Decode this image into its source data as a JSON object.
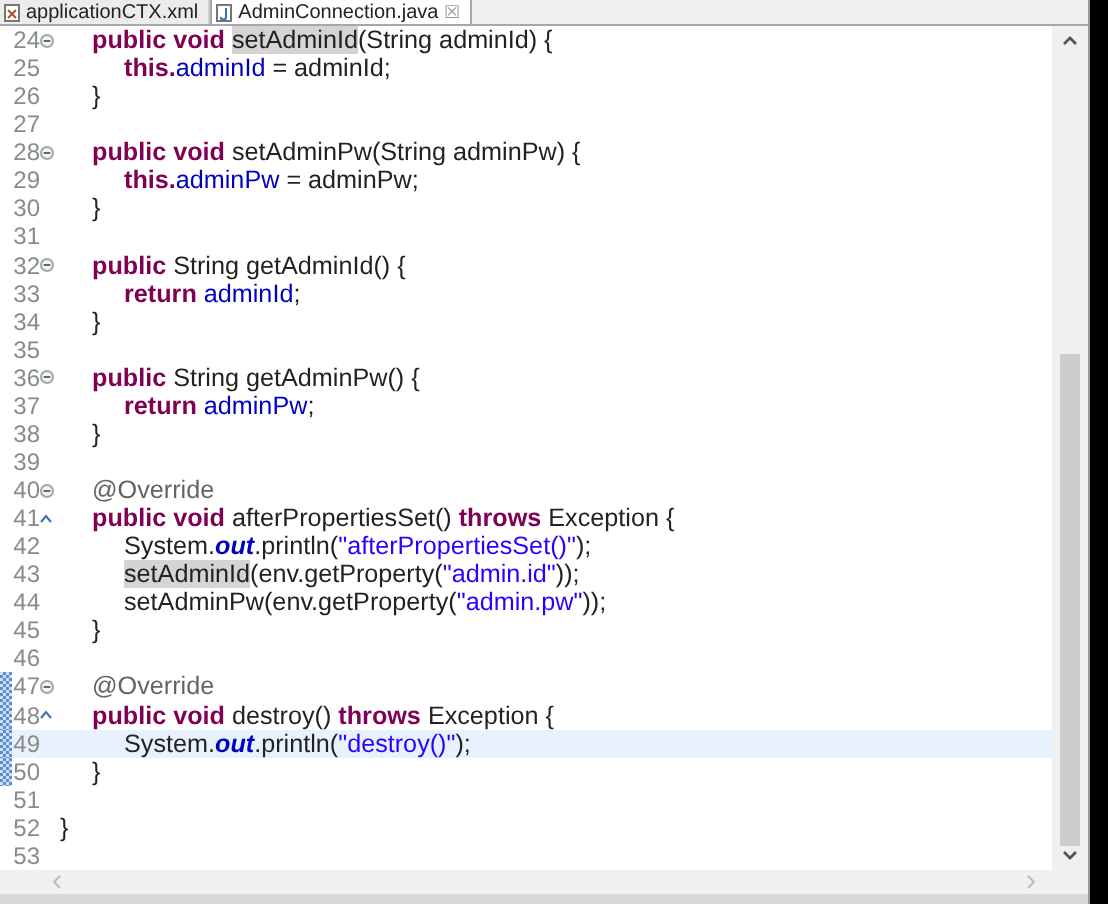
{
  "tabs": [
    {
      "label": "applicationCTX.xml",
      "kind": "xml",
      "selected": false
    },
    {
      "label": "AdminConnection.java",
      "kind": "java",
      "selected": true,
      "close": "☒"
    }
  ],
  "editor": {
    "lines": [
      {
        "number": "24",
        "fold": true,
        "override": false,
        "changed": false,
        "current": false,
        "tokens": [
          {
            "text": "\tpublic void ",
            "kind": "keyword"
          },
          {
            "text": "setAdminId",
            "kind": "occurrence"
          },
          {
            "text": "(String adminId) {",
            "kind": "plain"
          }
        ]
      },
      {
        "number": "25",
        "fold": false,
        "override": false,
        "changed": false,
        "current": false,
        "tokens": [
          {
            "text": "\t\tthis.",
            "kind": "keyword"
          },
          {
            "text": "adminId",
            "kind": "field"
          },
          {
            "text": " = adminId;",
            "kind": "plain"
          }
        ]
      },
      {
        "number": "26",
        "fold": false,
        "override": false,
        "changed": false,
        "current": false,
        "tokens": [
          {
            "text": "\t}",
            "kind": "plain"
          }
        ]
      },
      {
        "number": "27",
        "fold": false,
        "override": false,
        "changed": false,
        "current": false
      },
      {
        "number": "28",
        "fold": true,
        "override": false,
        "changed": false,
        "current": false,
        "tokens": [
          {
            "text": "\tpublic void ",
            "kind": "keyword"
          },
          {
            "text": "setAdminPw(String adminPw) {",
            "kind": "plain"
          }
        ]
      },
      {
        "number": "29",
        "fold": false,
        "override": false,
        "changed": false,
        "current": false,
        "tokens": [
          {
            "text": "\t\tthis.",
            "kind": "keyword"
          },
          {
            "text": "adminPw",
            "kind": "field"
          },
          {
            "text": " = adminPw;",
            "kind": "plain"
          }
        ]
      },
      {
        "number": "30",
        "fold": false,
        "override": false,
        "changed": false,
        "current": false,
        "tokens": [
          {
            "text": "\t}",
            "kind": "plain"
          }
        ]
      },
      {
        "number": "31",
        "fold": false,
        "override": false,
        "changed": false,
        "current": false
      },
      {
        "number": "32",
        "fold": true,
        "override": false,
        "changed": false,
        "current": false,
        "tokens": [
          {
            "text": "\tpublic ",
            "kind": "keyword"
          },
          {
            "text": "String getAdminId() {",
            "kind": "plain"
          }
        ]
      },
      {
        "number": "33",
        "fold": false,
        "override": false,
        "changed": false,
        "current": false,
        "tokens": [
          {
            "text": "\t\treturn ",
            "kind": "keyword"
          },
          {
            "text": "adminId",
            "kind": "field"
          },
          {
            "text": ";",
            "kind": "plain"
          }
        ]
      },
      {
        "number": "34",
        "fold": false,
        "override": false,
        "changed": false,
        "current": false,
        "tokens": [
          {
            "text": "\t}",
            "kind": "plain"
          }
        ]
      },
      {
        "number": "35",
        "fold": false,
        "override": false,
        "changed": false,
        "current": false
      },
      {
        "number": "36",
        "fold": true,
        "override": false,
        "changed": false,
        "current": false,
        "tokens": [
          {
            "text": "\tpublic ",
            "kind": "keyword"
          },
          {
            "text": "String getAdminPw() {",
            "kind": "plain"
          }
        ]
      },
      {
        "number": "37",
        "fold": false,
        "override": false,
        "changed": false,
        "current": false,
        "tokens": [
          {
            "text": "\t\treturn ",
            "kind": "keyword"
          },
          {
            "text": "adminPw",
            "kind": "field"
          },
          {
            "text": ";",
            "kind": "plain"
          }
        ]
      },
      {
        "number": "38",
        "fold": false,
        "override": false,
        "changed": false,
        "current": false,
        "tokens": [
          {
            "text": "\t}",
            "kind": "plain"
          }
        ]
      },
      {
        "number": "39",
        "fold": false,
        "override": false,
        "changed": false,
        "current": false
      },
      {
        "number": "40",
        "fold": true,
        "override": false,
        "changed": false,
        "current": false,
        "tokens": [
          {
            "text": "\t@Override",
            "kind": "annotation"
          }
        ]
      },
      {
        "number": "41",
        "fold": false,
        "override": true,
        "changed": false,
        "current": false,
        "tokens": [
          {
            "text": "\tpublic void ",
            "kind": "keyword"
          },
          {
            "text": "afterPropertiesSet() ",
            "kind": "plain"
          },
          {
            "text": "throws ",
            "kind": "keyword"
          },
          {
            "text": "Exception {",
            "kind": "plain"
          }
        ]
      },
      {
        "number": "42",
        "fold": false,
        "override": false,
        "changed": false,
        "current": false,
        "tokens": [
          {
            "text": "\t\tSystem.",
            "kind": "plain"
          },
          {
            "text": "out",
            "kind": "static"
          },
          {
            "text": ".println(",
            "kind": "plain"
          },
          {
            "text": "\"afterPropertiesSet()\"",
            "kind": "string"
          },
          {
            "text": ");",
            "kind": "plain"
          }
        ]
      },
      {
        "number": "43",
        "fold": false,
        "override": false,
        "changed": false,
        "current": false,
        "tokens": [
          {
            "text": "\t\tsetAdminId",
            "kind": "occurrence"
          },
          {
            "text": "(env.getProperty(",
            "kind": "plain"
          },
          {
            "text": "\"admin.id\"",
            "kind": "string"
          },
          {
            "text": "));",
            "kind": "plain"
          }
        ]
      },
      {
        "number": "44",
        "fold": false,
        "override": false,
        "changed": false,
        "current": false,
        "tokens": [
          {
            "text": "\t\tsetAdminPw(env.getProperty(",
            "kind": "plain"
          },
          {
            "text": "\"admin.pw\"",
            "kind": "string"
          },
          {
            "text": "));",
            "kind": "plain"
          }
        ]
      },
      {
        "number": "45",
        "fold": false,
        "override": false,
        "changed": false,
        "current": false,
        "tokens": [
          {
            "text": "\t}",
            "kind": "plain"
          }
        ]
      },
      {
        "number": "46",
        "fold": false,
        "override": false,
        "changed": false,
        "current": false
      },
      {
        "number": "47",
        "fold": true,
        "override": false,
        "changed": true,
        "current": false,
        "tokens": [
          {
            "text": "\t@Override",
            "kind": "annotation"
          }
        ]
      },
      {
        "number": "48",
        "fold": false,
        "override": true,
        "changed": true,
        "current": false,
        "tokens": [
          {
            "text": "\tpublic void ",
            "kind": "keyword"
          },
          {
            "text": "destroy() ",
            "kind": "plain"
          },
          {
            "text": "throws ",
            "kind": "keyword"
          },
          {
            "text": "Exception {",
            "kind": "plain"
          }
        ]
      },
      {
        "number": "49",
        "fold": false,
        "override": false,
        "changed": true,
        "current": true,
        "tokens": [
          {
            "text": "\t\tSystem.",
            "kind": "plain"
          },
          {
            "text": "out",
            "kind": "static"
          },
          {
            "text": ".println(",
            "kind": "plain"
          },
          {
            "text": "\"destroy()\"",
            "kind": "string"
          },
          {
            "text": ");",
            "kind": "plain"
          }
        ]
      },
      {
        "number": "50",
        "fold": false,
        "override": false,
        "changed": true,
        "current": false,
        "tokens": [
          {
            "text": "\t}",
            "kind": "plain"
          }
        ]
      },
      {
        "number": "51",
        "fold": false,
        "override": false,
        "changed": false,
        "current": false
      },
      {
        "number": "52",
        "fold": false,
        "override": false,
        "changed": false,
        "current": false,
        "tokens": [
          {
            "text": "}",
            "kind": "plain"
          }
        ]
      },
      {
        "number": "53",
        "fold": false,
        "override": false,
        "changed": false,
        "current": false
      }
    ]
  }
}
